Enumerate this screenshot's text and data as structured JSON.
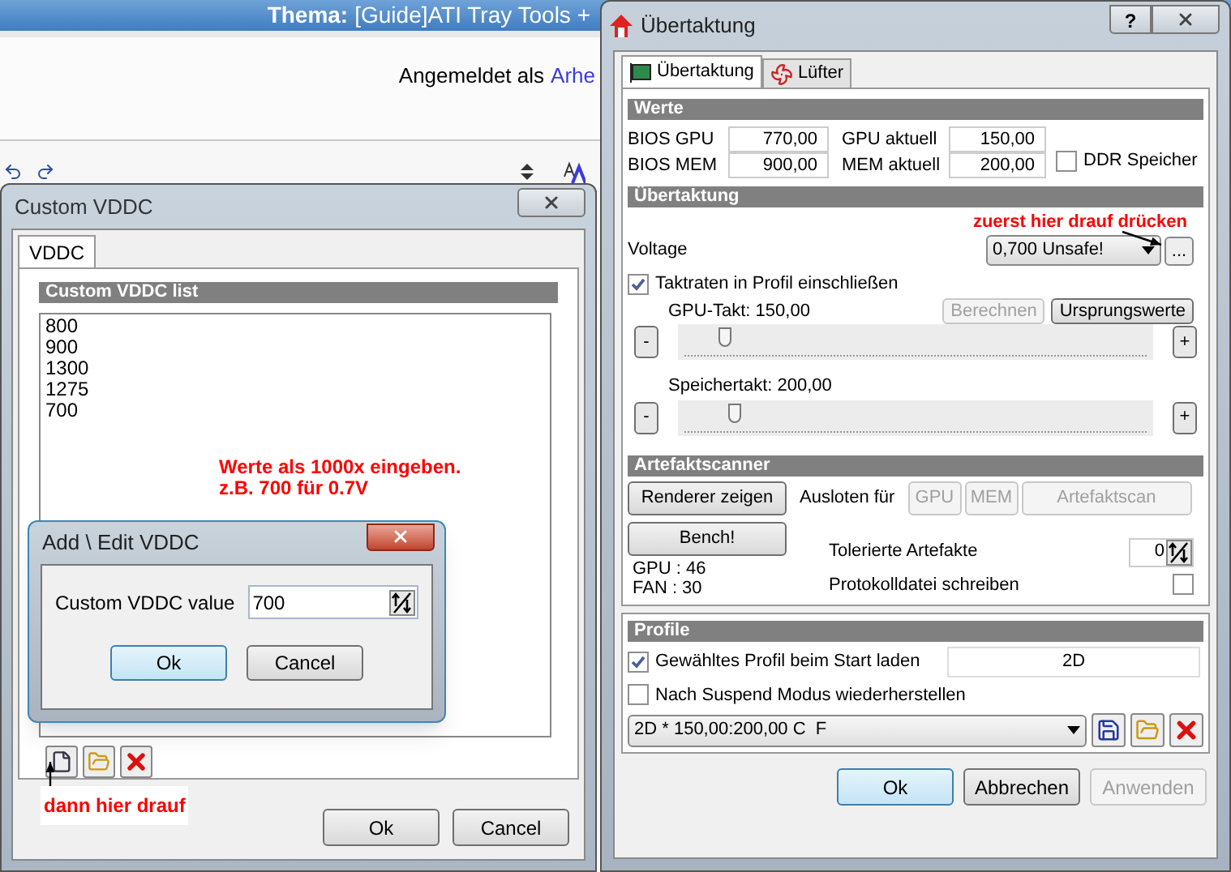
{
  "background_page": {
    "title_label": "Thema:",
    "title": "[Guide]ATI Tray Tools +",
    "logged_in_label": "Angemeldet als",
    "user": "Arhe"
  },
  "vddc_window": {
    "title": "Custom VDDC",
    "tabs": [
      {
        "label": "VDDC",
        "selected": true
      }
    ],
    "section": "Custom VDDC list",
    "items": [
      "800",
      "900",
      "1300",
      "1275",
      "700"
    ],
    "note_lines": [
      "Werte als 1000x eingeben.",
      "z.B. 700 für 0.7V"
    ],
    "hint": "dann hier drauf",
    "buttons": [
      {
        "label": "Ok",
        "focused": false
      },
      {
        "label": "Cancel",
        "focused": false
      }
    ]
  },
  "edit_dialog": {
    "title": "Add \\ Edit VDDC",
    "field_label": "Custom VDDC value",
    "value": "700",
    "buttons": [
      {
        "label": "Ok",
        "focused": true
      },
      {
        "label": "Cancel",
        "focused": false
      }
    ]
  },
  "oc_window": {
    "title": "Übertaktung",
    "help_button": "?",
    "tabs": [
      {
        "label": "Übertaktung",
        "selected": true
      },
      {
        "label": "Lüfter",
        "selected": false
      }
    ],
    "werte": {
      "header": "Werte",
      "bios_gpu_label": "BIOS GPU",
      "bios_gpu": "770,00",
      "bios_mem_label": "BIOS MEM",
      "bios_mem": "900,00",
      "gpu_now_label": "GPU aktuell",
      "gpu_now": "150,00",
      "mem_now_label": "MEM aktuell",
      "mem_now": "200,00",
      "ddr": {
        "label": "DDR Speicher",
        "checked": false
      }
    },
    "oc": {
      "header": "Übertaktung",
      "hint": "zuerst hier drauf drücken",
      "voltage_label": "Voltage",
      "voltage": "0,700 Unsafe!",
      "more_button": "...",
      "include": {
        "label": "Taktraten in Profil einschließen",
        "checked": true
      },
      "calc_buttons": [
        {
          "label": "Berechnen",
          "disabled": true
        },
        {
          "label": "Ursprungswerte",
          "disabled": false
        }
      ],
      "sliders": [
        {
          "label": "GPU-Takt: 150,00",
          "level": 0.1,
          "minus": "-",
          "plus": "+"
        },
        {
          "label": "Speichertakt: 200,00",
          "level": 0.12,
          "minus": "-",
          "plus": "+"
        }
      ]
    },
    "scanner": {
      "header": "Artefaktscanner",
      "render_button": "Renderer zeigen",
      "bench_button": "Bench!",
      "probe_label": "Ausloten für",
      "probe_buttons": [
        {
          "label": "GPU",
          "disabled": true
        },
        {
          "label": "MEM",
          "disabled": true
        },
        {
          "label": "Artefaktscan",
          "disabled": true
        }
      ],
      "tolerated_label": "Tolerierte Artefakte",
      "tolerated": "0",
      "gpu_temp": "GPU : 46",
      "fan": "FAN : 30",
      "log": {
        "label": "Protokolldatei schreiben",
        "checked": false
      }
    },
    "profile": {
      "header": "Profile",
      "load": {
        "label": "Gewähltes Profil beim Start laden",
        "checked": true
      },
      "load_value": "2D",
      "restore": {
        "label": "Nach Suspend Modus wiederherstellen",
        "checked": false
      },
      "selected_profile": "2D * 150,00:200,00 C  F"
    },
    "buttons": [
      {
        "label": "Ok",
        "focused": true,
        "disabled": false
      },
      {
        "label": "Abbrechen",
        "focused": false,
        "disabled": false
      },
      {
        "label": "Anwenden",
        "focused": false,
        "disabled": true
      }
    ]
  }
}
